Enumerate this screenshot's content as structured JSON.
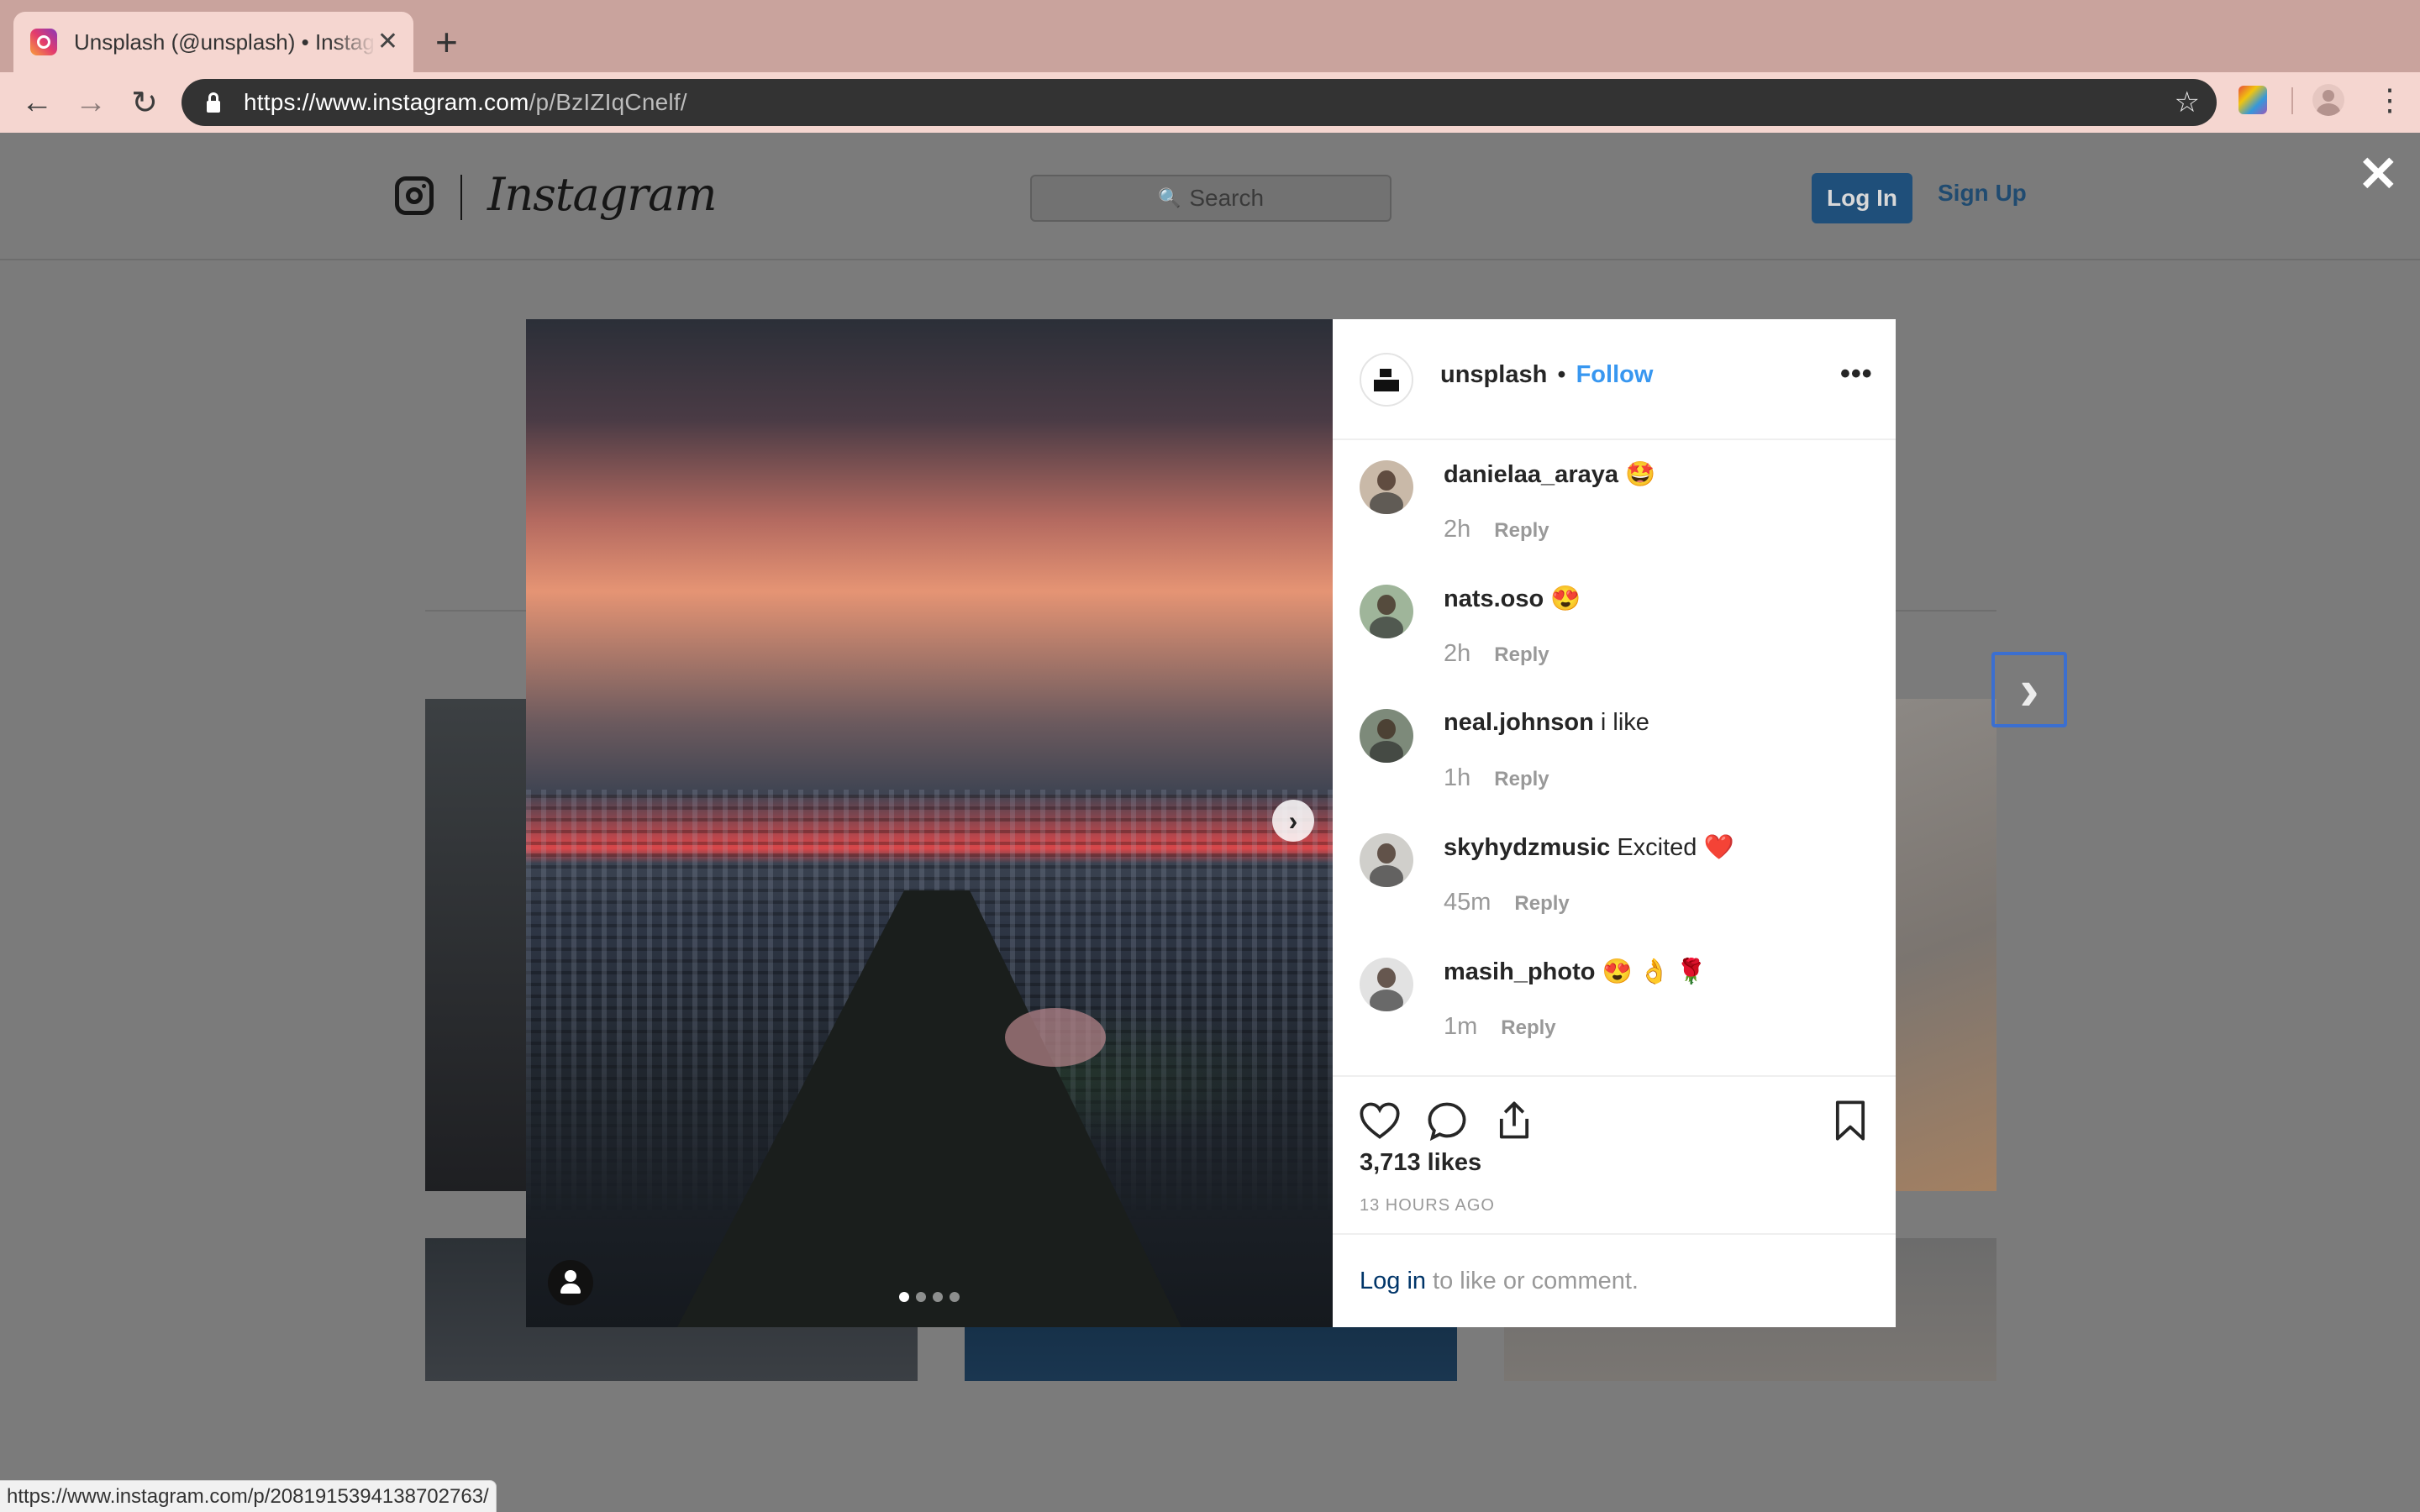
{
  "browser": {
    "tab_title": "Unsplash (@unsplash) • Instagram photos and videos",
    "tab_close": "✕",
    "new_tab": "+",
    "back": "←",
    "forward": "→",
    "reload": "↻",
    "url_host": "https://www.instagram.com",
    "url_path": "/p/BzIZIqCnelf/",
    "bookmark": "☆",
    "menu": "⋮",
    "status_url": "https://www.instagram.com/p/2081915394138702763/"
  },
  "ig_header": {
    "wordmark": "Instagram",
    "search_placeholder": "Search",
    "search_glyph": "🔍",
    "login_label": "Log In",
    "signup_label": "Sign Up",
    "close_modal": "✕",
    "next_post": "›"
  },
  "post": {
    "owner": "unsplash",
    "separator": "•",
    "follow_label": "Follow",
    "more": "•••",
    "photo_next": "›",
    "carousel_slides": 4,
    "carousel_active": 1,
    "comments": [
      {
        "user": "danielaa_araya",
        "text": "🤩",
        "time": "2h",
        "reply": "Reply",
        "avatar_color": "#c9b9a8"
      },
      {
        "user": "nats.oso",
        "text": "😍",
        "time": "2h",
        "reply": "Reply",
        "avatar_color": "#9fb59a"
      },
      {
        "user": "neal.johnson",
        "text": "i like",
        "time": "1h",
        "reply": "Reply",
        "avatar_color": "#7d8a7a"
      },
      {
        "user": "skyhydzmusic",
        "text": "Excited ❤️",
        "time": "45m",
        "reply": "Reply",
        "avatar_color": "#d0cfcb"
      },
      {
        "user": "masih_photo",
        "text": "😍 👌 🌹",
        "time": "1m",
        "reply": "Reply",
        "avatar_color": "#e2e2e2"
      }
    ],
    "likes": "3,713 likes",
    "time_ago": "13 HOURS AGO",
    "footer_login": "Log in",
    "footer_text": "to like or comment."
  }
}
